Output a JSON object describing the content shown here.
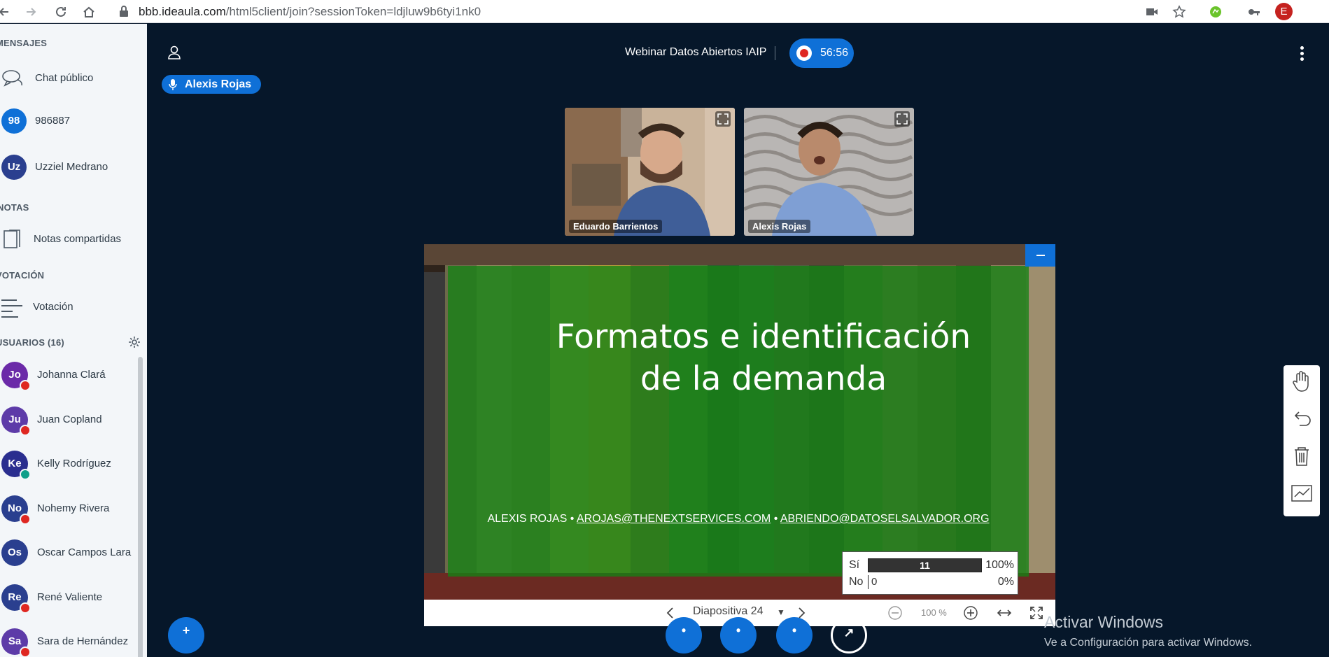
{
  "browser": {
    "url_host": "bbb.ideaula.com",
    "url_path": "/html5client/join?sessionToken=ldjluw9b6tyi1nk0",
    "profile_initial": "E"
  },
  "sidebar": {
    "messages_label": "MENSAJES",
    "public_chat": "Chat público",
    "private_chats": [
      {
        "initials": "98",
        "name": "986887",
        "color": "#0f70d7"
      },
      {
        "initials": "Uz",
        "name": "Uzziel Medrano",
        "color": "#2a3f8f"
      }
    ],
    "notes_label": "NOTAS",
    "shared_notes": "Notas compartidas",
    "voting_label": "VOTACIÓN",
    "voting": "Votación",
    "users_label": "USUARIOS (16)",
    "users": [
      {
        "initials": "Jo",
        "name": "Johanna Clará",
        "color": "#6b2aa8",
        "status": "muted"
      },
      {
        "initials": "Ju",
        "name": "Juan Copland",
        "color": "#5d3ba8",
        "status": "muted"
      },
      {
        "initials": "Ke",
        "name": "Kelly Rodríguez",
        "color": "#2a2e8f",
        "status": "listen"
      },
      {
        "initials": "No",
        "name": "Nohemy Rivera",
        "color": "#2a3f8f",
        "status": "muted"
      },
      {
        "initials": "Os",
        "name": "Oscar Campos Lara",
        "color": "#2a3f8f",
        "status": "none"
      },
      {
        "initials": "Re",
        "name": "René Valiente",
        "color": "#2a3f8f",
        "status": "muted"
      },
      {
        "initials": "Sa",
        "name": "Sara de Hernández",
        "color": "#5d3ba8",
        "status": "muted"
      }
    ]
  },
  "header": {
    "meeting_title": "Webinar Datos Abiertos IAIP",
    "recording_time": "56:56",
    "talking_user": "Alexis Rojas"
  },
  "webcams": [
    {
      "name": "Eduardo Barrientos"
    },
    {
      "name": "Alexis Rojas"
    }
  ],
  "slide": {
    "title_line1": "Formatos e identificación",
    "title_line2": "de la demanda",
    "footer_name": "ALEXIS ROJAS",
    "footer_sep": "•",
    "footer_email1": "AROJAS@THENEXTSERVICES.COM",
    "footer_email2": "ABRIENDO@DATOSELSALVADOR.ORG"
  },
  "poll": {
    "rows": [
      {
        "label": "Sí",
        "count": "11",
        "percent": "100%",
        "fraction": 1.0
      },
      {
        "label": "No",
        "count": "0",
        "percent": "0%",
        "fraction": 0.0
      }
    ]
  },
  "presentation_toolbar": {
    "slide_label": "Diapositiva 24",
    "zoom": "100 %"
  },
  "windows_watermark": {
    "title": "Activar Windows",
    "subtitle": "Ve a Configuración para activar Windows."
  },
  "colors": {
    "accent": "#0f70d7",
    "background": "#06172a",
    "sidebar": "#f3f6f9",
    "record": "#df2721"
  }
}
